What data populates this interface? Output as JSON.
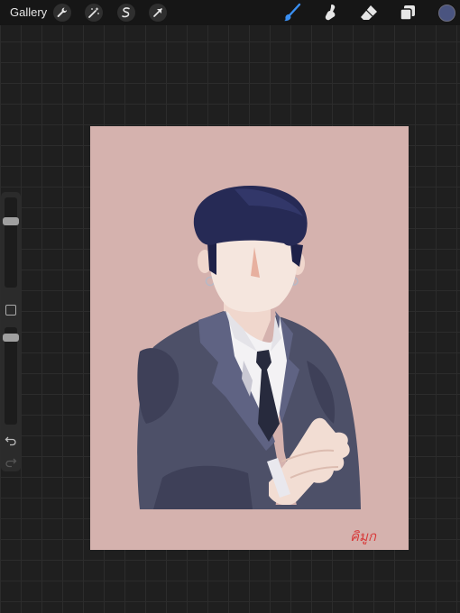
{
  "topbar": {
    "gallery_label": "Gallery",
    "tools_left": [
      "wrench-icon",
      "magic-wand-icon",
      "selection-icon",
      "transform-arrow-icon"
    ],
    "tools_right": [
      "brush-icon",
      "smudge-icon",
      "eraser-icon",
      "layers-icon"
    ],
    "active_tool": "brush-icon",
    "active_color": "#4a5480"
  },
  "sidebar": {
    "brush_size_level": 0.1,
    "opacity_level": 0.06
  },
  "canvas": {
    "background_color": "#d5b2ae",
    "signature_text": "คิมูก"
  }
}
